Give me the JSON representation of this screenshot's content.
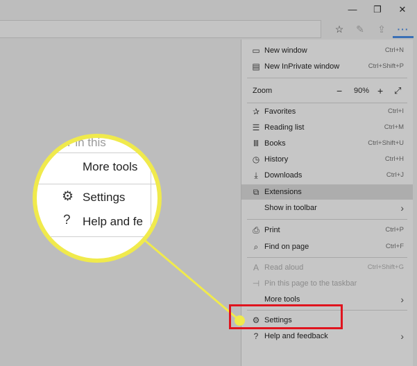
{
  "window": {
    "minimize_icon": "minimize-icon",
    "maximize_icon": "restore-icon",
    "close_icon": "close-icon"
  },
  "toolbar": {
    "icons": [
      "favorites-star-icon",
      "pen-icon",
      "share-icon",
      "more-ellipsis-icon"
    ],
    "more_label": "···"
  },
  "menu": {
    "new_window": {
      "label": "New window",
      "shortcut": "Ctrl+N",
      "icon": "window-icon"
    },
    "new_inprivate": {
      "label": "New InPrivate window",
      "shortcut": "Ctrl+Shift+P",
      "icon": "inprivate-icon"
    },
    "zoom": {
      "label": "Zoom",
      "minus": "−",
      "value": "90%",
      "plus": "+",
      "fullscreen": "⤢"
    },
    "favorites": {
      "label": "Favorites",
      "shortcut": "Ctrl+I",
      "icon": "favorites-icon"
    },
    "reading_list": {
      "label": "Reading list",
      "shortcut": "Ctrl+M",
      "icon": "reading-list-icon"
    },
    "books": {
      "label": "Books",
      "shortcut": "Ctrl+Shift+U",
      "icon": "books-icon"
    },
    "history": {
      "label": "History",
      "shortcut": "Ctrl+H",
      "icon": "history-icon"
    },
    "downloads": {
      "label": "Downloads",
      "shortcut": "Ctrl+J",
      "icon": "download-icon"
    },
    "extensions": {
      "label": "Extensions",
      "icon": "extensions-icon"
    },
    "show_in_toolbar": {
      "label": "Show in toolbar"
    },
    "print": {
      "label": "Print",
      "shortcut": "Ctrl+P",
      "icon": "print-icon"
    },
    "find_on_page": {
      "label": "Find on page",
      "shortcut": "Ctrl+F",
      "icon": "search-icon"
    },
    "read_aloud": {
      "label": "Read aloud",
      "shortcut": "Ctrl+Shift+G",
      "icon": "read-aloud-icon"
    },
    "pin_taskbar": {
      "label": "Pin this page to the taskbar",
      "icon": "pin-icon"
    },
    "more_tools": {
      "label": "More tools"
    },
    "settings": {
      "label": "Settings",
      "icon": "gear-icon"
    },
    "help": {
      "label": "Help and feedback",
      "icon": "help-icon"
    }
  },
  "magnifier": {
    "pin_partial": "Pin this",
    "more_tools": "More tools",
    "settings": "Settings",
    "help_partial": "Help and fe"
  },
  "colors": {
    "highlight_circle": "#f0ea4c",
    "callout_box": "#e0141e",
    "accent": "#3a6fb5"
  }
}
